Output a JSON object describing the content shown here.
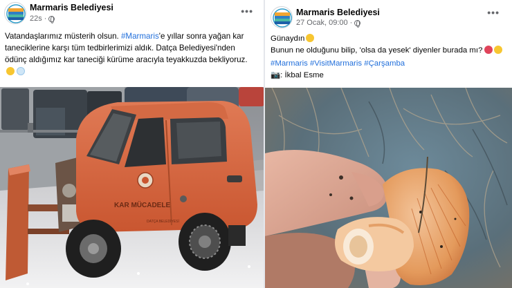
{
  "left_post": {
    "page_name": "Marmaris Belediyesi",
    "time": "22s",
    "text_lines": [
      "Vatandaşlarımız müsterih olsun.",
      "#Marmaris",
      "'e yıllar sonra yağan kar",
      "taneciklerine karşı tüm tedbirlerimizi aldık. Datça Belediyesi'nden",
      "ödünç aldığımız kar taneciği kürüme aracıyla teyakkuzda bekliyoruz."
    ],
    "car_text": "KAR MÜCADELE",
    "car_text_small": "DATÇA BELEDİYESİ"
  },
  "right_post": {
    "page_name": "Marmaris Belediyesi",
    "time": "27 Ocak, 09:00",
    "greeting": "Günaydın",
    "question": "Bunun ne olduğunu bilip, 'olsa da yesek' diyenler burada mı?",
    "hashtags": "#Marmaris #VisitMarmaris #Çarşamba",
    "credit": "📷: İkbal Esme"
  },
  "icons": {
    "globe": "globe-icon",
    "more": "more-options-icon",
    "avatar": "marmaris-logo"
  },
  "colors": {
    "hashtag": "#216fdb",
    "meta": "#65676b",
    "car": "#d8633d"
  }
}
